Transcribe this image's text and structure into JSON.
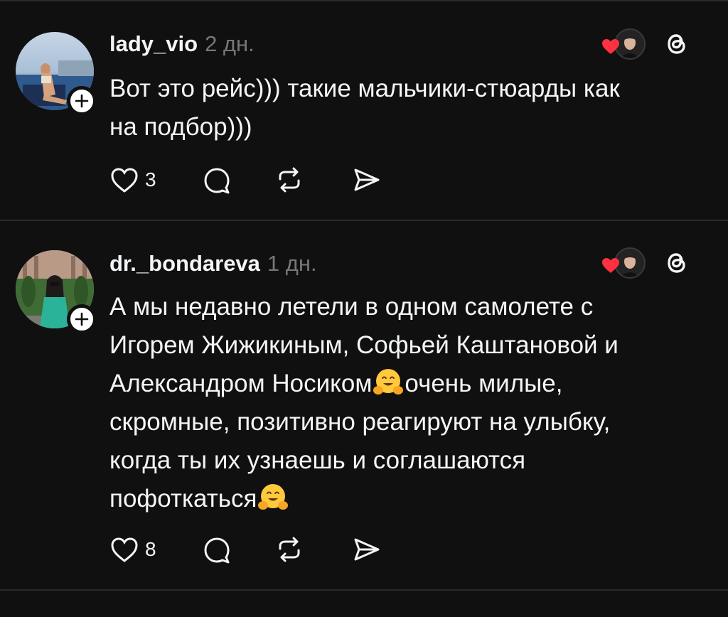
{
  "posts": [
    {
      "username": "lady_vio",
      "time": "2 дн.",
      "lines": [
        "Вот это рейс))) такие мальчики-стюарды как",
        "на подбор)))"
      ],
      "like_count": "3"
    },
    {
      "username": "dr._bondareva",
      "time": "1 дн.",
      "lines": [
        "А мы недавно летели в одном самолете с",
        "Игорем Жижикиным, Софьей Каштановой и",
        "Александром Носиком",
        "очень милые,",
        "скромные, позитивно реагируют на улыбку,",
        "когда ты их узнаешь и соглашаются",
        "пофоткаться"
      ],
      "like_count": "8"
    }
  ],
  "icons": {
    "follow": "plus-icon",
    "liked_by": "heart-icon",
    "app": "threads-logo-icon",
    "like": "heart-outline-icon",
    "reply": "comment-icon",
    "repost": "repost-icon",
    "share": "send-icon",
    "emoji": "hugging-face-emoji"
  },
  "colors": {
    "background": "#101010",
    "heart": "#ff3040",
    "muted": "#777777"
  }
}
